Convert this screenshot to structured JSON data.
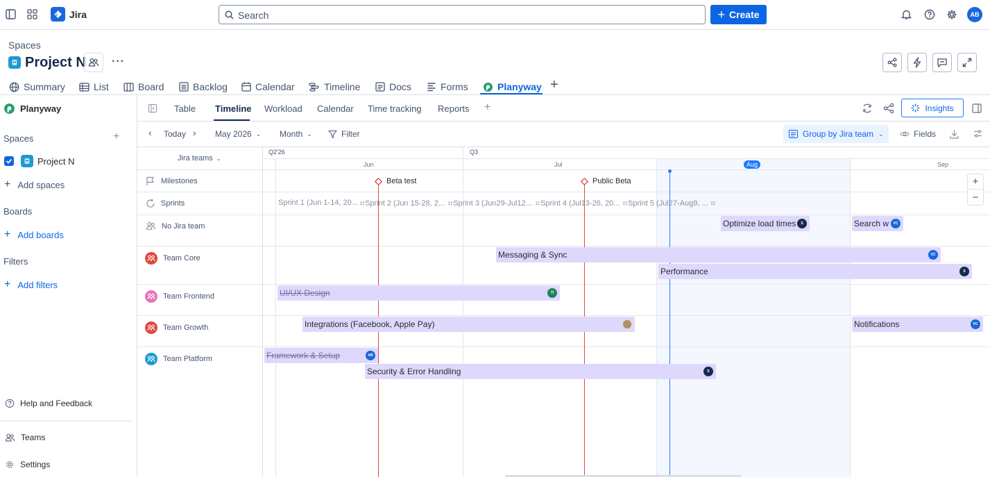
{
  "topbar": {
    "app_name": "Jira",
    "search_placeholder": "Search",
    "create_label": "Create",
    "avatar_initials": "AB"
  },
  "header": {
    "breadcrumb": "Spaces",
    "project_title": "Project N",
    "tabs": [
      {
        "label": "Summary",
        "icon": "globe-icon"
      },
      {
        "label": "List",
        "icon": "list-icon"
      },
      {
        "label": "Board",
        "icon": "board-icon"
      },
      {
        "label": "Backlog",
        "icon": "backlog-icon"
      },
      {
        "label": "Calendar",
        "icon": "calendar-icon"
      },
      {
        "label": "Timeline",
        "icon": "timeline-icon"
      },
      {
        "label": "Docs",
        "icon": "docs-icon"
      },
      {
        "label": "Forms",
        "icon": "forms-icon"
      },
      {
        "label": "Planyway",
        "icon": "planyway-icon",
        "active": true
      }
    ]
  },
  "sidebar": {
    "app_title": "Planyway",
    "spaces_label": "Spaces",
    "project_item": "Project N",
    "add_spaces": "Add spaces",
    "boards_label": "Boards",
    "add_boards": "Add boards",
    "filters_label": "Filters",
    "add_filters": "Add filters",
    "help": "Help and Feedback",
    "teams": "Teams",
    "settings": "Settings"
  },
  "subtabs": {
    "items": [
      "Table",
      "Timeline",
      "Workload",
      "Calendar",
      "Time tracking",
      "Reports"
    ],
    "active": "Timeline",
    "insights_label": "Insights"
  },
  "toolbar": {
    "today": "Today",
    "period": "May 2026",
    "scale": "Month",
    "filter": "Filter",
    "group_by": "Group by Jira team",
    "fields": "Fields"
  },
  "timeline": {
    "column_header": "Jira teams",
    "quarters": [
      "Q2'26",
      "Q3"
    ],
    "months": [
      "Jun",
      "Jul",
      "Aug",
      "Sep"
    ],
    "current_month": "Aug",
    "rows": {
      "milestones": "Milestones",
      "sprints": "Sprints",
      "no_team": "No Jira team",
      "team_core": "Team Core",
      "team_frontend": "Team Frontend",
      "team_growth": "Team Growth",
      "team_platform": "Team Platform"
    },
    "milestones": [
      "Beta test",
      "Public Beta"
    ],
    "sprints": [
      "Sprint 1 (Jun 1-14, 20...",
      "Sprint 2 (Jun 15-28, 2...",
      "Sprint 3 (Jun29-Jul12...",
      "Sprint 4 (Jul13-26, 20...",
      "Sprint 5 (Jul27-Aug9, ..."
    ],
    "bars": {
      "optimize": {
        "label": "Optimize load times",
        "avatar": "S"
      },
      "search": {
        "label": "Search w",
        "avatar": "VC"
      },
      "messaging": {
        "label": "Messaging & Sync",
        "avatar": "VC"
      },
      "performance": {
        "label": "Performance",
        "avatar": "S"
      },
      "uiux": {
        "label": "UI/UX Design",
        "avatar": "TI",
        "done": true
      },
      "integrations": {
        "label": "Integrations (Facebook, Apple Pay)",
        "avatar": "photo"
      },
      "notifications": {
        "label": "Notifications",
        "avatar": "VC"
      },
      "framework": {
        "label": "Framework & Setup",
        "avatar": "AB",
        "done": true
      },
      "security": {
        "label": "Security & Error Handling",
        "avatar": "S"
      }
    },
    "zoom_in": "+",
    "zoom_out": "−"
  },
  "colors": {
    "brand_blue": "#0c66e4",
    "bar_purple": "#dfd8fd",
    "milestone_red": "#e2483d",
    "today_line": "#1d7afc",
    "planyway_green": "#22a06b"
  }
}
